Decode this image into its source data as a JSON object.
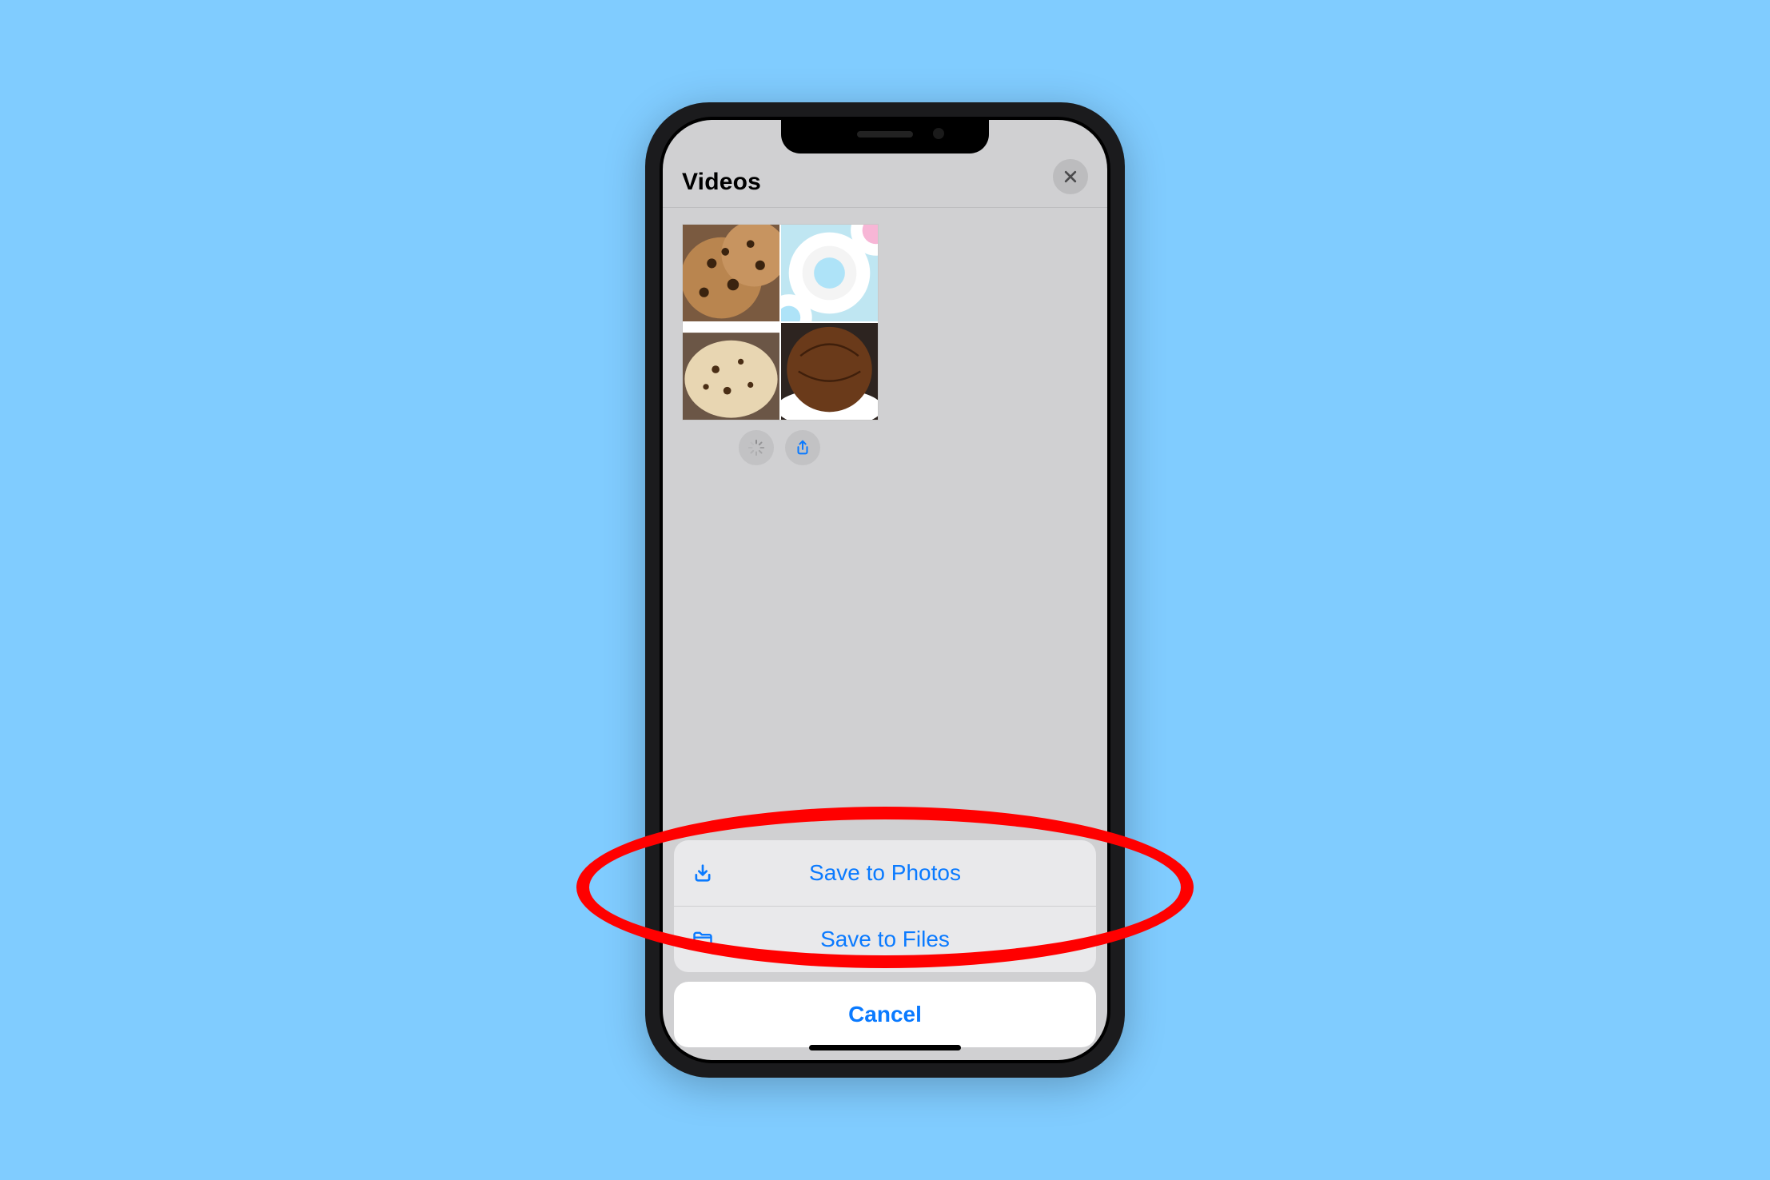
{
  "header": {
    "title": "Videos",
    "close_icon": "close-icon"
  },
  "thumbnail": {
    "loading_icon": "loading-icon",
    "share_icon": "share-icon"
  },
  "action_sheet": {
    "items": [
      {
        "label": "Save to Photos",
        "icon": "download-icon"
      },
      {
        "label": "Save to Files",
        "icon": "folder-icon"
      }
    ],
    "cancel_label": "Cancel"
  },
  "annotation": {
    "highlight": "Save to Files",
    "color": "#ff0000"
  }
}
